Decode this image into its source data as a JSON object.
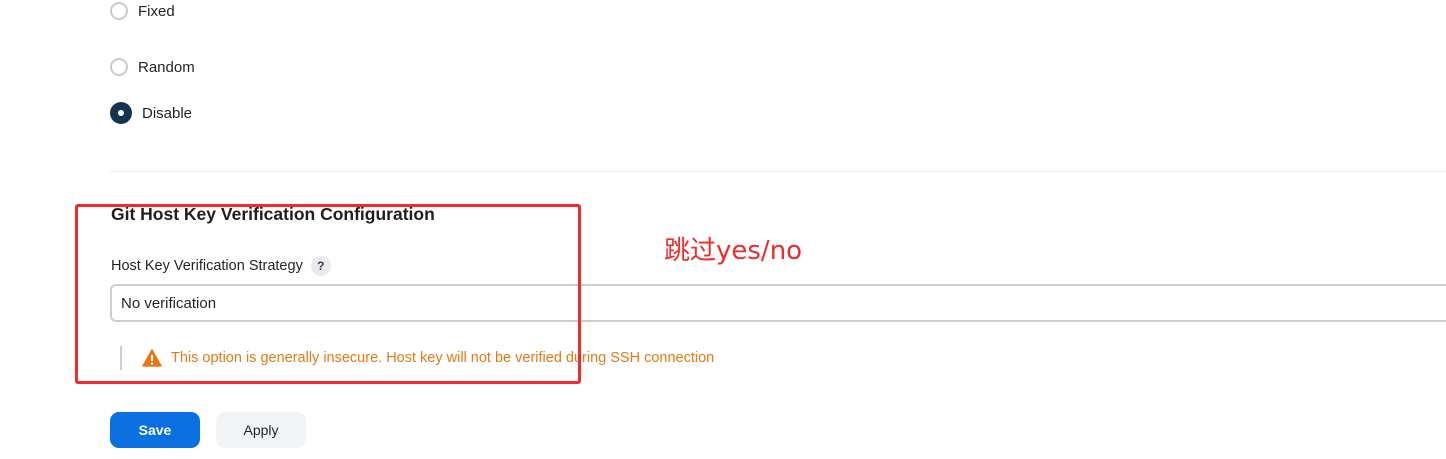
{
  "radio_group": {
    "options": [
      {
        "label": "Fixed",
        "checked": false
      },
      {
        "label": "Random",
        "checked": false
      },
      {
        "label": "Disable",
        "checked": true
      }
    ]
  },
  "section": {
    "title": "Git Host Key Verification Configuration",
    "field_label": "Host Key Verification Strategy",
    "help_glyph": "?",
    "selected_strategy": "No verification",
    "warning": "This option is generally insecure. Host key will not be verified during SSH connection"
  },
  "annotation": {
    "text": "跳过yes/no",
    "color": "#ef2b2b"
  },
  "buttons": {
    "save": "Save",
    "apply": "Apply"
  },
  "colors": {
    "primary": "#0a6fe1",
    "warning": "#e37a16",
    "radio_checked": "#14334f"
  }
}
